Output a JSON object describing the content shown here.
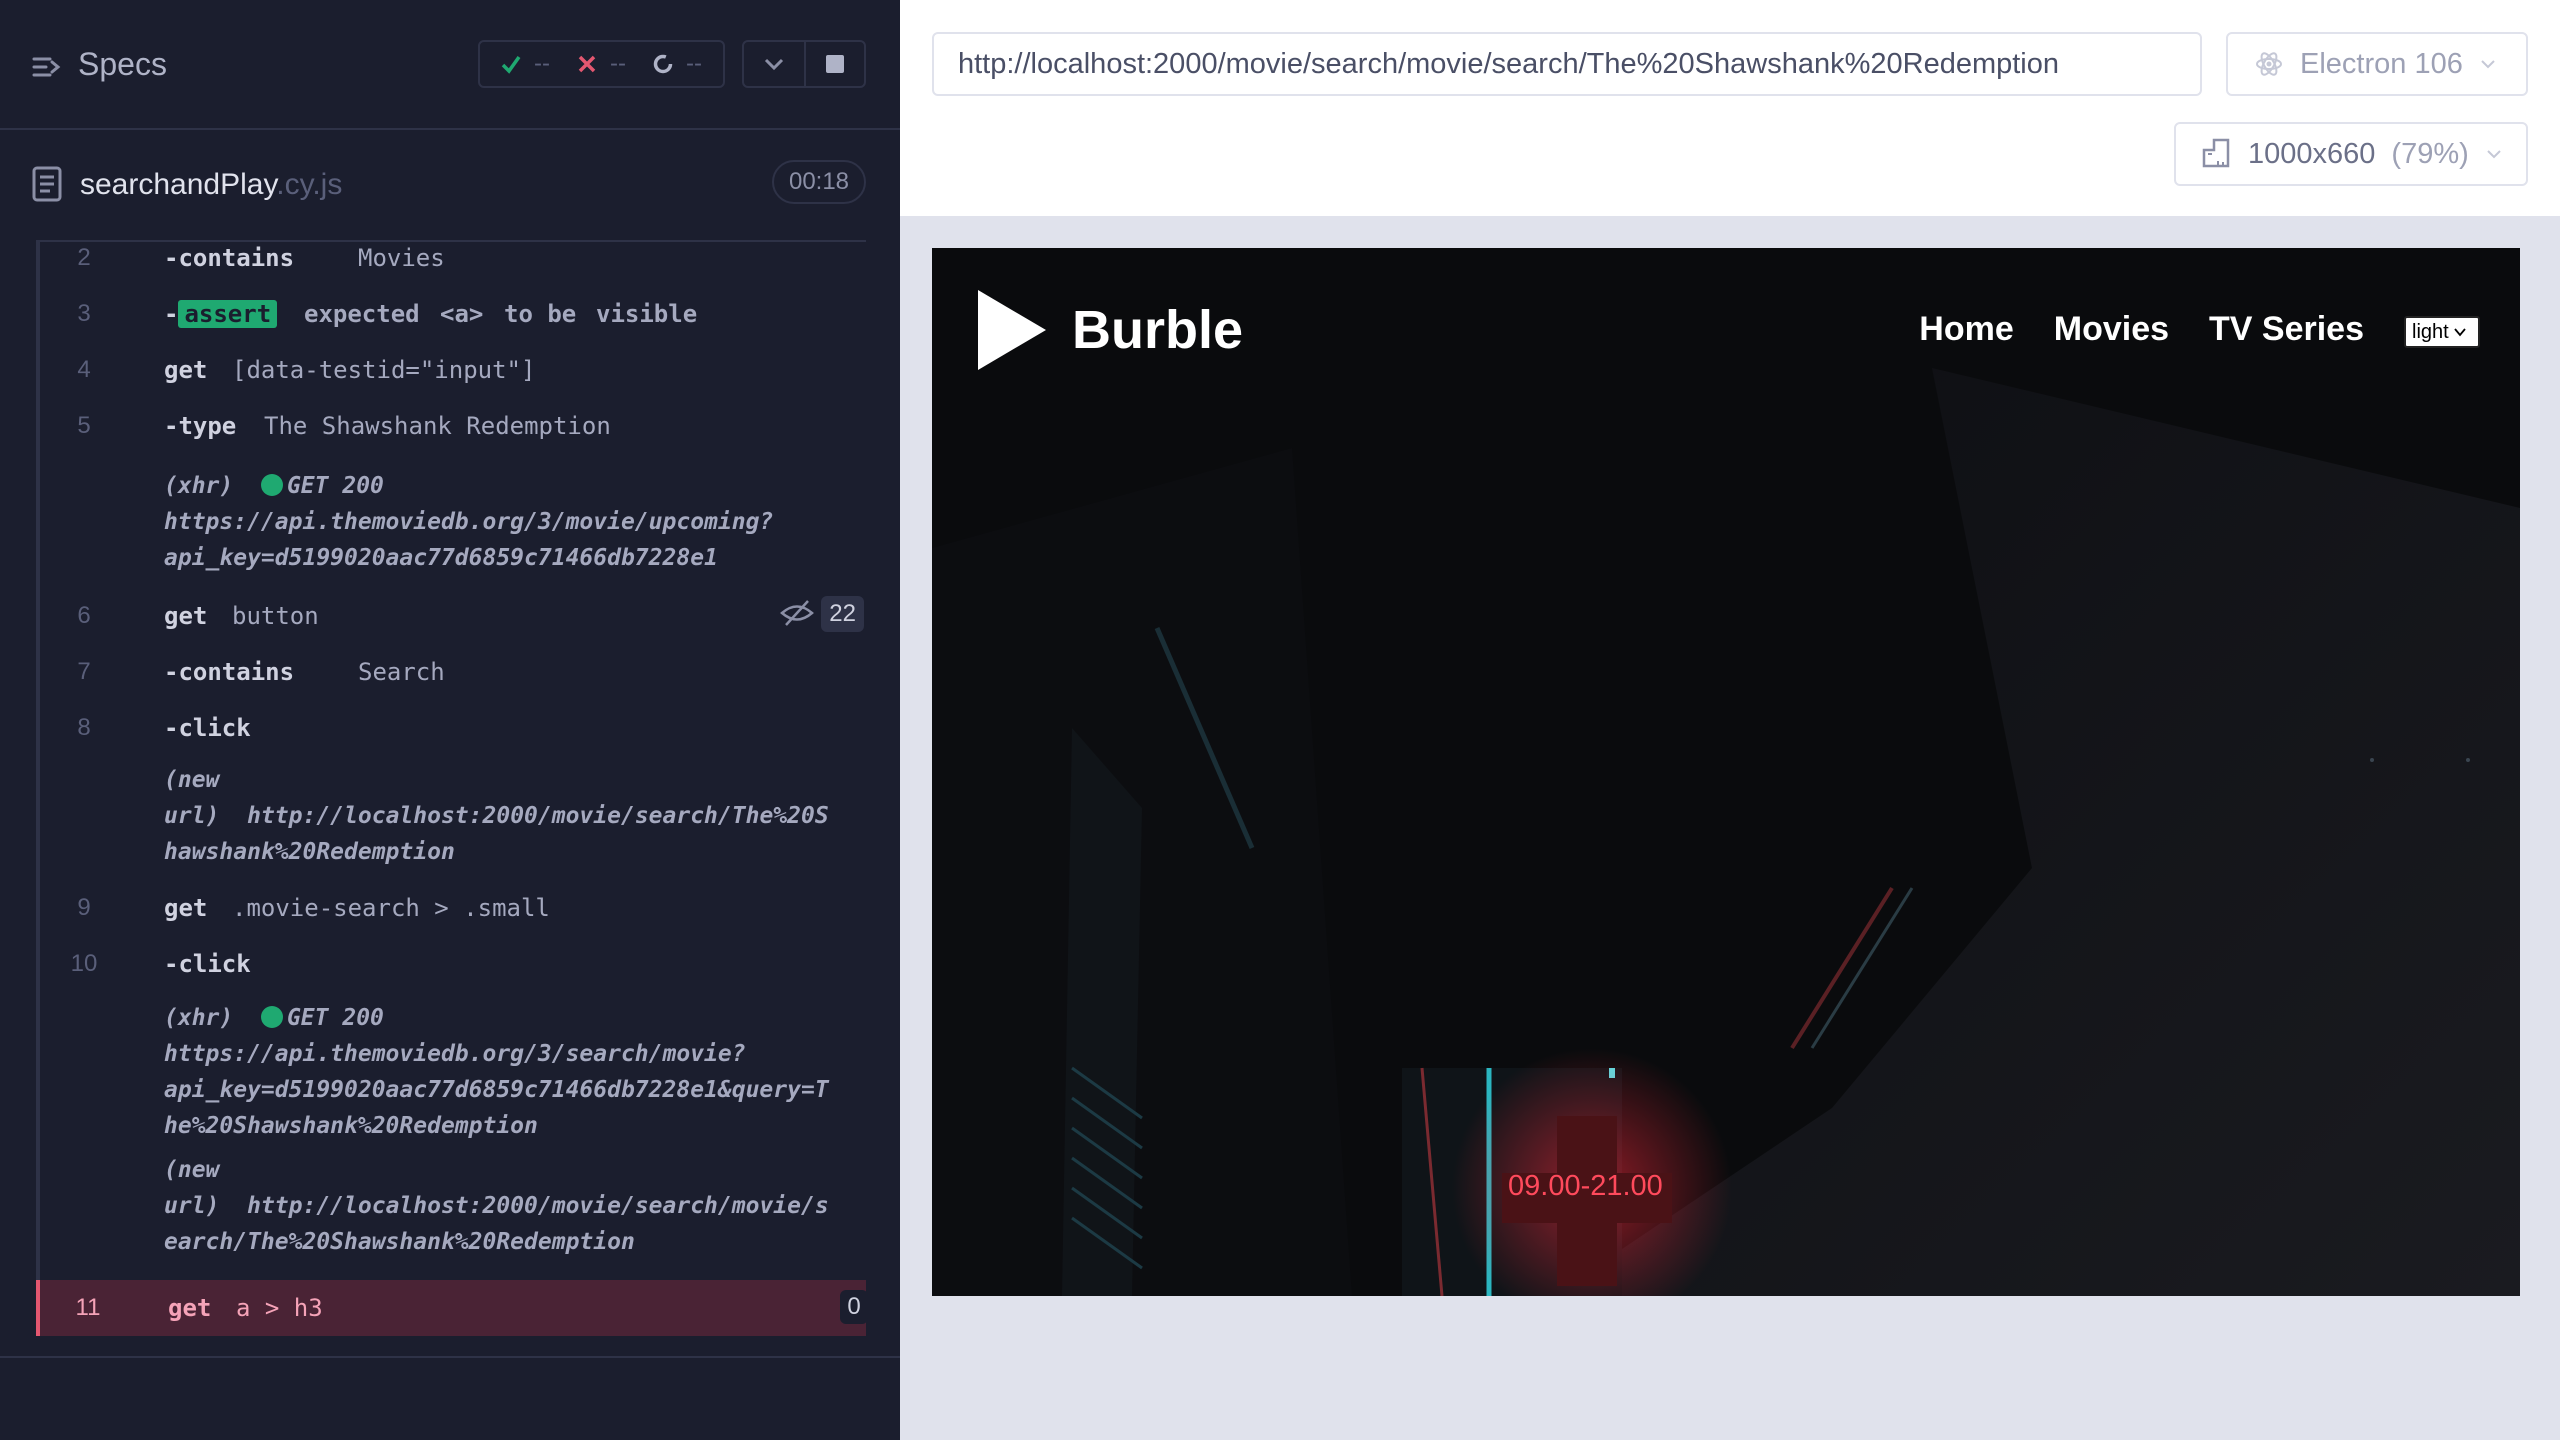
{
  "reporter": {
    "title": "Specs",
    "stats": {
      "passed": "--",
      "failed": "--",
      "pending": "--"
    },
    "file": {
      "name": "searchandPlay",
      "ext": ".cy.js",
      "duration": "00:18"
    },
    "commands": [
      {
        "num": "2",
        "name": "contains",
        "msg": "Movies"
      },
      {
        "num": "3",
        "name": "assert",
        "msg_parts": [
          "expected",
          "<a>",
          "to be",
          "visible"
        ]
      },
      {
        "num": "4",
        "name": "get",
        "msg": "[data-testid=\"input\"]"
      },
      {
        "num": "5",
        "name": "type",
        "msg": "The Shawshank Redemption"
      },
      {
        "num": "6",
        "name": "get",
        "msg": "button",
        "count": "22"
      },
      {
        "num": "7",
        "name": "contains",
        "msg": "Search"
      },
      {
        "num": "8",
        "name": "click",
        "msg": ""
      },
      {
        "num": "9",
        "name": "get",
        "msg": ".movie-search > .small"
      },
      {
        "num": "10",
        "name": "click",
        "msg": ""
      },
      {
        "num": "11",
        "name": "get",
        "msg": "a > h3",
        "count": "0"
      }
    ],
    "logs": {
      "xhr1_label": "(xhr)",
      "xhr1_status": "GET 200",
      "xhr1_url_1": "https://api.themoviedb.org/3/movie/upcoming?",
      "xhr1_url_2": "api_key=d5199020aac77d6859c71466db7228e1",
      "newurl1_l1": "(new",
      "newurl1_l2a": "url)",
      "newurl1_l2b": "http://localhost:2000/movie/search/The%20S",
      "newurl1_l3": "hawshank%20Redemption",
      "xhr2_label": "(xhr)",
      "xhr2_status": "GET 200",
      "xhr2_url_1": "https://api.themoviedb.org/3/search/movie?",
      "xhr2_url_2": "api_key=d5199020aac77d6859c71466db7228e1&query=T",
      "xhr2_url_3": "he%20Shawshank%20Redemption",
      "newurl2_l1": "(new",
      "newurl2_l2a": "url)",
      "newurl2_l2b": "http://localhost:2000/movie/search/movie/s",
      "newurl2_l3": "earch/The%20Shawshank%20Redemption"
    }
  },
  "aut": {
    "url": "http://localhost:2000/movie/search/movie/search/The%20Shawshank%20Redemption",
    "browser": "Electron 106",
    "viewport": "1000x660",
    "viewport_pct": "(79%)"
  },
  "app": {
    "name": "Burble",
    "nav": [
      "Home",
      "Movies",
      "TV Series"
    ],
    "theme_value": "light",
    "sign_text": "09.00-21.00"
  },
  "colors": {
    "accent_green": "#1fa971",
    "fail_red": "#e45770",
    "reporter_bg": "#1b1e2e"
  }
}
